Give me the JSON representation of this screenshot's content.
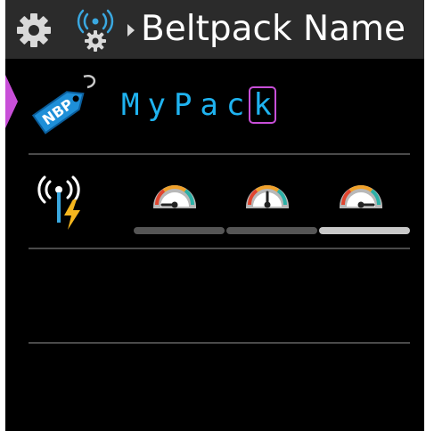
{
  "header": {
    "title": "Beltpack Name",
    "icons": [
      "gear-icon",
      "wireless-settings-icon",
      "breadcrumb-arrow-icon"
    ]
  },
  "name_field": {
    "value_prefix": "MyPac",
    "cursor_char": "k",
    "tag_icon_label": "NBP",
    "icon": "name-tag-icon"
  },
  "signal_row": {
    "icon": "antenna-power-icon",
    "gauges": [
      {
        "name": "gauge-low",
        "level": "low"
      },
      {
        "name": "gauge-medium",
        "level": "medium"
      },
      {
        "name": "gauge-high",
        "level": "high"
      }
    ],
    "selected_segment": 3
  },
  "colors": {
    "accent": "#c84fd8",
    "text_cyan": "#1fb3f0",
    "header_bg": "#2b2b2b",
    "bar_inactive": "#555555",
    "bar_active": "#c8c8c8",
    "lightning": "#f5b61e"
  }
}
